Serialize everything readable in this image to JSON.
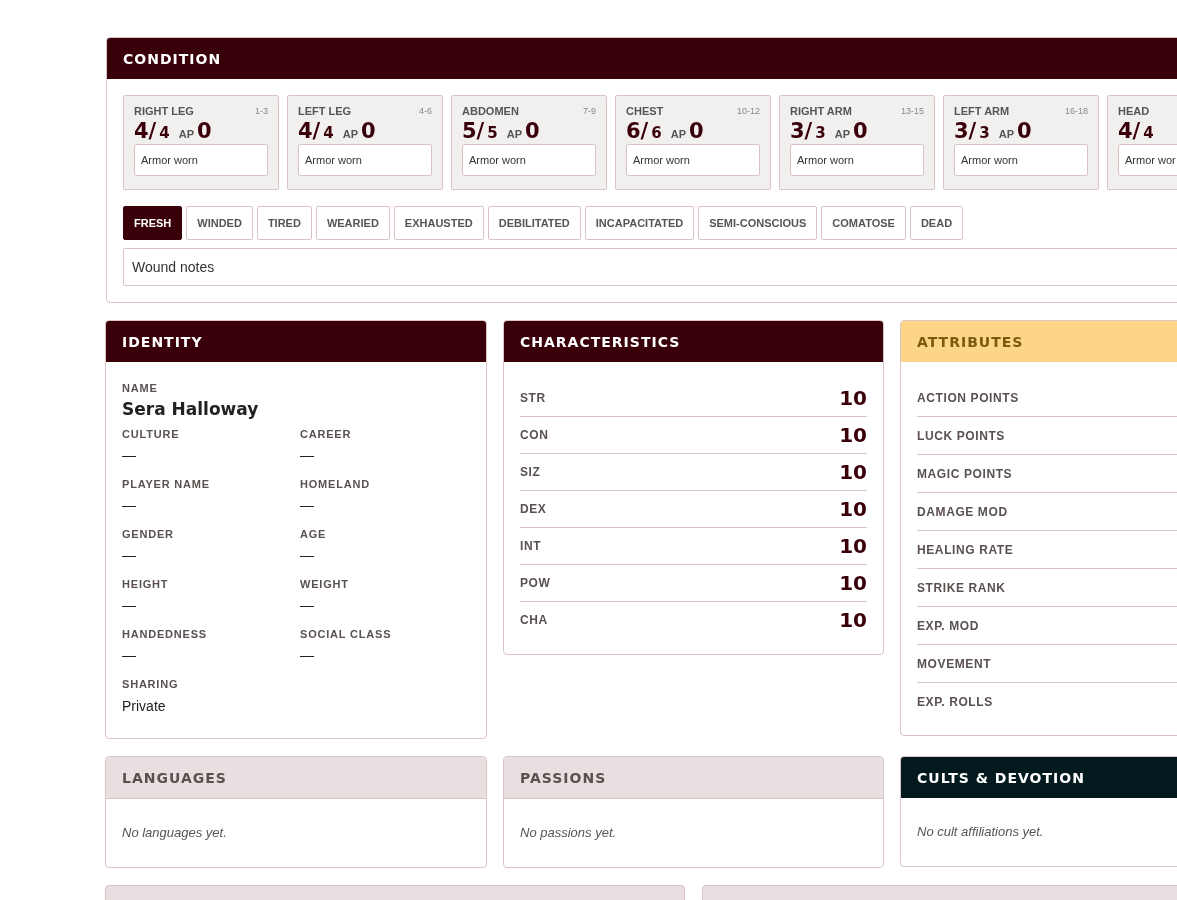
{
  "condition": {
    "title": "CONDITION",
    "locations": [
      {
        "name": "RIGHT LEG",
        "range": "1-3",
        "current": "4/",
        "max": "4",
        "ap_label": "AP",
        "ap": "0",
        "armor_placeholder": "Armor worn"
      },
      {
        "name": "LEFT LEG",
        "range": "4-6",
        "current": "4/",
        "max": "4",
        "ap_label": "AP",
        "ap": "0",
        "armor_placeholder": "Armor worn"
      },
      {
        "name": "ABDOMEN",
        "range": "7-9",
        "current": "5/",
        "max": "5",
        "ap_label": "AP",
        "ap": "0",
        "armor_placeholder": "Armor worn"
      },
      {
        "name": "CHEST",
        "range": "10-12",
        "current": "6/",
        "max": "6",
        "ap_label": "AP",
        "ap": "0",
        "armor_placeholder": "Armor worn"
      },
      {
        "name": "RIGHT ARM",
        "range": "13-15",
        "current": "3/",
        "max": "3",
        "ap_label": "AP",
        "ap": "0",
        "armor_placeholder": "Armor worn"
      },
      {
        "name": "LEFT ARM",
        "range": "16-18",
        "current": "3/",
        "max": "3",
        "ap_label": "AP",
        "ap": "0",
        "armor_placeholder": "Armor worn"
      },
      {
        "name": "HEAD",
        "current": "4/",
        "max": "4",
        "armor_placeholder": "Armor wor"
      }
    ],
    "fatigue": [
      {
        "label": "FRESH",
        "selected": true
      },
      {
        "label": "WINDED",
        "selected": false
      },
      {
        "label": "TIRED",
        "selected": false
      },
      {
        "label": "WEARIED",
        "selected": false
      },
      {
        "label": "EXHAUSTED",
        "selected": false
      },
      {
        "label": "DEBILITATED",
        "selected": false
      },
      {
        "label": "INCAPACITATED",
        "selected": false
      },
      {
        "label": "SEMI-CONSCIOUS",
        "selected": false
      },
      {
        "label": "COMATOSE",
        "selected": false
      },
      {
        "label": "DEAD",
        "selected": false
      }
    ],
    "notes_placeholder": "Wound notes"
  },
  "identity": {
    "title": "IDENTITY",
    "name_label": "NAME",
    "name": "Sera Halloway",
    "fields": [
      {
        "label": "CULTURE",
        "value": "—"
      },
      {
        "label": "CAREER",
        "value": "—"
      },
      {
        "label": "PLAYER NAME",
        "value": "—"
      },
      {
        "label": "HOMELAND",
        "value": "—"
      },
      {
        "label": "GENDER",
        "value": "—"
      },
      {
        "label": "AGE",
        "value": "—"
      },
      {
        "label": "HEIGHT",
        "value": "—"
      },
      {
        "label": "WEIGHT",
        "value": "—"
      },
      {
        "label": "HANDEDNESS",
        "value": "—"
      },
      {
        "label": "SOCIAL CLASS",
        "value": "—"
      }
    ],
    "sharing_label": "SHARING",
    "sharing": "Private"
  },
  "characteristics": {
    "title": "CHARACTERISTICS",
    "rows": [
      {
        "label": "STR",
        "value": "10"
      },
      {
        "label": "CON",
        "value": "10"
      },
      {
        "label": "SIZ",
        "value": "10"
      },
      {
        "label": "DEX",
        "value": "10"
      },
      {
        "label": "INT",
        "value": "10"
      },
      {
        "label": "POW",
        "value": "10"
      },
      {
        "label": "CHA",
        "value": "10"
      }
    ]
  },
  "attributes": {
    "title": "ATTRIBUTES",
    "rows": [
      "ACTION POINTS",
      "LUCK POINTS",
      "MAGIC POINTS",
      "DAMAGE MOD",
      "HEALING RATE",
      "STRIKE RANK",
      "EXP. MOD",
      "MOVEMENT",
      "EXP. ROLLS"
    ]
  },
  "lists": [
    {
      "kind": "muted",
      "title": "LANGUAGES",
      "empty": "No languages yet."
    },
    {
      "kind": "muted",
      "title": "PASSIONS",
      "empty": "No passions yet."
    },
    {
      "kind": "dark",
      "title": "CULTS & DEVOTION",
      "empty": "No cult affiliations yet."
    }
  ]
}
